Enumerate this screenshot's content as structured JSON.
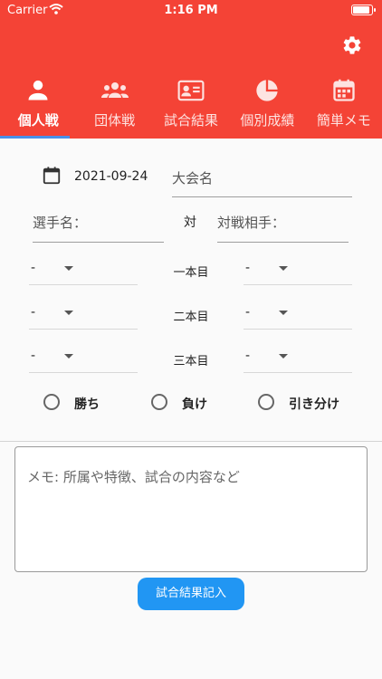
{
  "status_bar": {
    "carrier": "Carrier",
    "time": "1:16 PM"
  },
  "header": {
    "background_color": "#f44336",
    "settings_icon": "gear-icon"
  },
  "tabs": [
    {
      "label": "個人戦",
      "icon": "person-icon",
      "active": true
    },
    {
      "label": "団体戦",
      "icon": "group-icon",
      "active": false
    },
    {
      "label": "試合結果",
      "icon": "id-card-icon",
      "active": false
    },
    {
      "label": "個別成績",
      "icon": "pie-chart-icon",
      "active": false
    },
    {
      "label": "簡単メモ",
      "icon": "calendar-icon",
      "active": false
    }
  ],
  "form": {
    "date": "2021-09-24",
    "tournament_placeholder": "大会名",
    "player_placeholder": "選手名：",
    "vs_label": "対",
    "opponent_placeholder": "対戦相手：",
    "rounds": [
      {
        "label": "一本目",
        "left_value": "-",
        "right_value": "-"
      },
      {
        "label": "二本目",
        "left_value": "-",
        "right_value": "-"
      },
      {
        "label": "三本目",
        "left_value": "-",
        "right_value": "-"
      }
    ],
    "result_options": [
      "勝ち",
      "負け",
      "引き分け"
    ],
    "memo_placeholder": "メモ: 所属や特徴、試合の内容など",
    "submit_label": "試合結果記入"
  },
  "colors": {
    "accent": "#f44336",
    "tab_indicator": "#4a8fe7",
    "button": "#2196f3"
  }
}
